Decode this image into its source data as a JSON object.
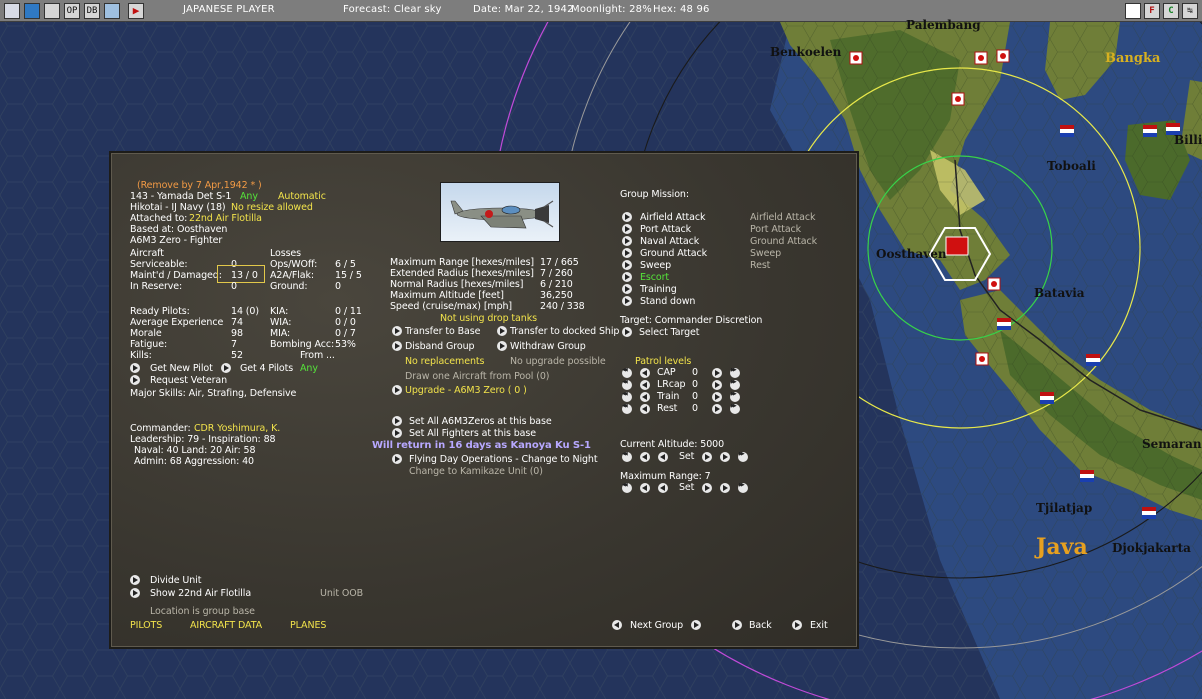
{
  "topbar": {
    "icons": [
      "world-icon",
      "globe-icon",
      "swap-icon",
      "op-icon",
      "db-icon",
      "window-icon",
      "play-icon"
    ],
    "op_label": "OP",
    "db_label": "DB",
    "player": "JAPANESE PLAYER",
    "forecast": "Forecast: Clear sky",
    "date": "Date: Mar 22, 1942",
    "moonlight": "Moonlight: 28%",
    "hex": "Hex: 48 96",
    "right_icons": [
      "f-icon",
      "c-icon",
      "exit-icon"
    ],
    "right_labels": [
      "F",
      "C",
      ""
    ]
  },
  "map": {
    "labels": {
      "palembang": "Palembang",
      "benkoelen": "Benkoelen",
      "bangka": "Bangka",
      "toboali": "Toboali",
      "billiton": "Billit",
      "oosthaven": "Oosthaven",
      "batavia": "Batavia",
      "semarang": "Semarang",
      "tjilatjap": "Tjilatjap",
      "java": "Java",
      "djokjakarta": "Djokjakarta"
    },
    "colors": {
      "sea": "#24345c",
      "land": "#6d7d3a",
      "jungle": "#3f5a2c",
      "label": "#111111",
      "bangka_label": "#d7b020",
      "java_label": "#e6a020"
    }
  },
  "panel": {
    "remove_by": "(Remove by  7 Apr,1942 * )",
    "unit_name": "143 - Yamada Det S-1",
    "unit_any": "Any",
    "unit_auto": "Automatic",
    "hikotai": "Hikotai - IJ Navy (18)",
    "no_resize": "No resize allowed",
    "attached_label": "Attached to:",
    "attached_value": "22nd Air Flotilla",
    "based_at": "Based at:  Oosthaven",
    "aircraft_type": "A6M3 Zero - Fighter",
    "aircraft_header": "Aircraft",
    "serviceable_label": "Serviceable:",
    "serviceable_value": "0",
    "maintd_label": "Maint'd / Damaged:",
    "maintd_value": "13 / 0",
    "reserve_label": "In Reserve:",
    "reserve_value": "0",
    "losses_header": "Losses",
    "opswoff_label": "Ops/WOff:",
    "opswoff_value": "6 / 5",
    "a2a_label": "A2A/Flak:",
    "a2a_value": "15 / 5",
    "ground_label": "Ground:",
    "ground_value": "0",
    "ready_label": "Ready Pilots:",
    "ready_value": "14 (0)",
    "avgexp_label": "Average Experience",
    "avgexp_value": "74",
    "morale_label": "Morale",
    "morale_value": "98",
    "fatigue_label": "Fatigue:",
    "fatigue_value": "7",
    "kills_label": "Kills:",
    "kills_value": "52",
    "kia_label": "KIA:",
    "kia_value": "0 / 11",
    "wia_label": "WIA:",
    "wia_value": "0 / 0",
    "mia_label": "MIA:",
    "mia_value": "0 / 7",
    "bombacc_label": "Bombing Acc:",
    "bombacc_value": "53%",
    "from_label": "From ...",
    "get_new_pilot": "Get New Pilot",
    "get_4_pilots": "Get 4 Pilots",
    "get_4_any": "Any",
    "request_veteran": "Request Veteran",
    "major_skills": "Major Skills: Air, Strafing, Defensive",
    "commander_label": "Commander:",
    "commander_value": "CDR Yoshimura, K.",
    "leadership": "Leadership: 79 - Inspiration: 88",
    "naval_line": "Naval: 40  Land: 20  Air: 58",
    "admin_line": "Admin: 68  Aggression: 40",
    "max_range_label": "Maximum Range [hexes/miles]",
    "max_range_value": "17 / 665",
    "ext_radius_label": "Extended Radius [hexes/miles]",
    "ext_radius_value": "7 / 260",
    "norm_radius_label": "Normal Radius [hexes/miles]",
    "norm_radius_value": "6 / 210",
    "max_alt_label": "Maximum Altitude [feet]",
    "max_alt_value": "36,250",
    "speed_label": "Speed (cruise/max) [mph]",
    "speed_value": "240 / 338",
    "drop_tanks": "Not using drop tanks",
    "transfer_base": "Transfer to Base",
    "transfer_ship": "Transfer to docked Ship",
    "disband": "Disband Group",
    "withdraw": "Withdraw Group",
    "no_replacements": "No replacements",
    "no_upgrade": "No upgrade possible",
    "draw_aircraft": "Draw one Aircraft from Pool (0)",
    "upgrade": "Upgrade - A6M3 Zero  ( 0 )",
    "set_all_zeros": "Set All A6M3Zeros at this base",
    "set_all_fighters": "Set All Fighters at this base",
    "will_return": "Will return in 16 days as Kanoya Ku S-1",
    "flying_ops": "Flying Day Operations - Change to Night",
    "kamikaze": "Change to Kamikaze Unit (0)",
    "group_mission": "Group Mission:",
    "missions": [
      "Airfield Attack",
      "Port Attack",
      "Naval Attack",
      "Ground Attack",
      "Sweep",
      "Escort",
      "Training",
      "Stand down"
    ],
    "missions_secondary": [
      "Airfield Attack",
      "Port Attack",
      "Ground Attack",
      "Sweep",
      "Rest"
    ],
    "target_line": "Target: Commander Discretion",
    "select_target": "Select Target",
    "patrol_levels": "Patrol levels",
    "patrol_rows": [
      {
        "label": "CAP",
        "value": "0"
      },
      {
        "label": "LRcap",
        "value": "0"
      },
      {
        "label": "Train",
        "value": "0"
      },
      {
        "label": "Rest",
        "value": "0"
      }
    ],
    "current_alt": "Current Altitude: 5000",
    "set_label": "Set",
    "max_range_line": "Maximum Range: 7",
    "divide_unit": "Divide Unit",
    "show_flotilla": "Show 22nd Air Flotilla",
    "unit_oob": "Unit OOB",
    "location_group": "Location is group base",
    "tab_pilots": "PILOTS",
    "tab_aircraft": "AIRCRAFT DATA",
    "tab_planes": "PLANES",
    "next_group": "Next Group",
    "back": "Back",
    "exit": "Exit"
  }
}
